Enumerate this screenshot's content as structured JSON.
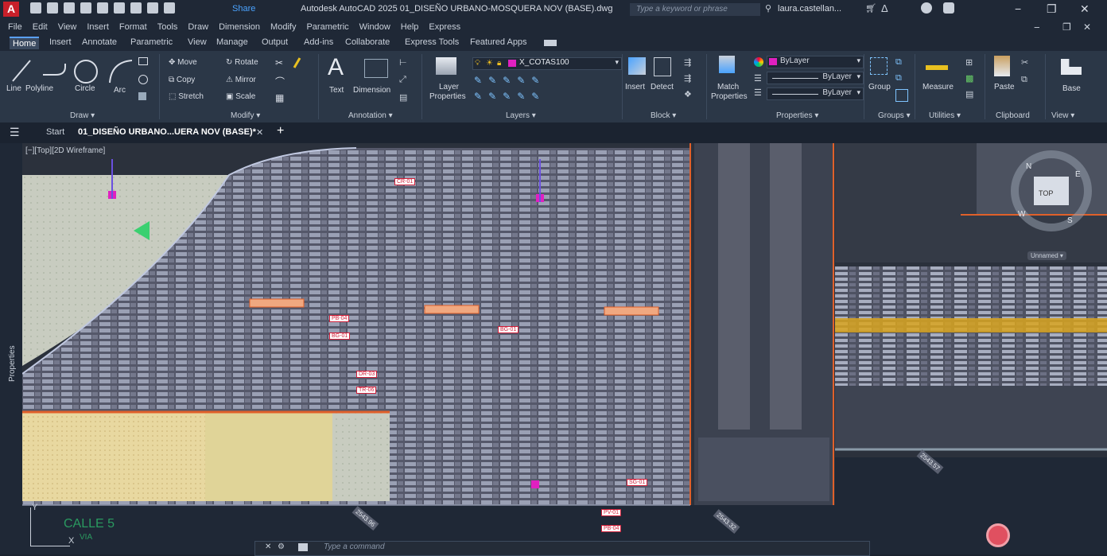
{
  "app": {
    "logo_letter": "A",
    "share_label": "Share",
    "window_title": "Autodesk AutoCAD 2025   01_DISEÑO URBANO-MOSQUERA NOV (BASE).dwg",
    "search_placeholder": "Type a keyword or phrase",
    "user_name": "laura.castellan...",
    "minimize": "−",
    "maximize": "❐",
    "close": "✕"
  },
  "menu": [
    "File",
    "Edit",
    "View",
    "Insert",
    "Format",
    "Tools",
    "Draw",
    "Dimension",
    "Modify",
    "Parametric",
    "Window",
    "Help",
    "Express"
  ],
  "ribbon_tabs": [
    "Home",
    "Insert",
    "Annotate",
    "Parametric",
    "View",
    "Manage",
    "Output",
    "Add-ins",
    "Collaborate",
    "Express Tools",
    "Featured Apps"
  ],
  "draw": {
    "line": "Line",
    "polyline": "Polyline",
    "circle": "Circle",
    "arc": "Arc",
    "panel": "Draw ▾"
  },
  "modify": {
    "move": "Move",
    "rotate": "Rotate",
    "copy": "Copy",
    "mirror": "Mirror",
    "stretch": "Stretch",
    "scale": "Scale",
    "panel": "Modify ▾"
  },
  "annotation": {
    "text": "Text",
    "dimension": "Dimension",
    "panel": "Annotation ▾"
  },
  "layers": {
    "layer_properties_1": "Layer",
    "layer_properties_2": "Properties",
    "current_layer": "X_COTAS100",
    "panel": "Layers ▾"
  },
  "block": {
    "insert": "Insert",
    "detect": "Detect",
    "panel": "Block ▾"
  },
  "properties": {
    "match_1": "Match",
    "match_2": "Properties",
    "color": "ByLayer",
    "linetype": "ByLayer",
    "lineweight": "ByLayer",
    "panel": "Properties ▾"
  },
  "groups": {
    "group": "Group",
    "panel": "Groups ▾"
  },
  "utilities": {
    "measure": "Measure",
    "panel": "Utilities ▾"
  },
  "clipboard": {
    "paste": "Paste",
    "panel": "Clipboard"
  },
  "view": {
    "base": "Base",
    "panel": "View ▾"
  },
  "file_tabs": {
    "start": "Start",
    "active": "01_DISEÑO URBANO...UERA NOV (BASE)*",
    "close": "✕",
    "add": "+"
  },
  "viewport": {
    "label": "[−][Top][2D Wireframe]",
    "sidebar_label": "Properties",
    "viewcube_top": "TOP",
    "viewcube_n": "N",
    "viewcube_e": "E",
    "viewcube_s": "S",
    "viewcube_w": "W",
    "ucs_label": "Unnamed ▾",
    "street_1": "CALLE 5",
    "street_2": "VIA",
    "axis_y": "Y",
    "axis_x": "X",
    "command_placeholder": "Type a command"
  },
  "tags": [
    "CR-01",
    "PB-04",
    "BG-01",
    "BG-01",
    "DR-03",
    "TR-06",
    "PV-01",
    "PB-04",
    "SG-01"
  ],
  "dims": [
    "2543.57",
    "2543.32",
    "2543.96"
  ],
  "colors": {
    "accent": "#5aa0ff",
    "layer_magenta": "#e020c0",
    "orange": "#e0602a",
    "yellow_band": "#d9a520"
  }
}
